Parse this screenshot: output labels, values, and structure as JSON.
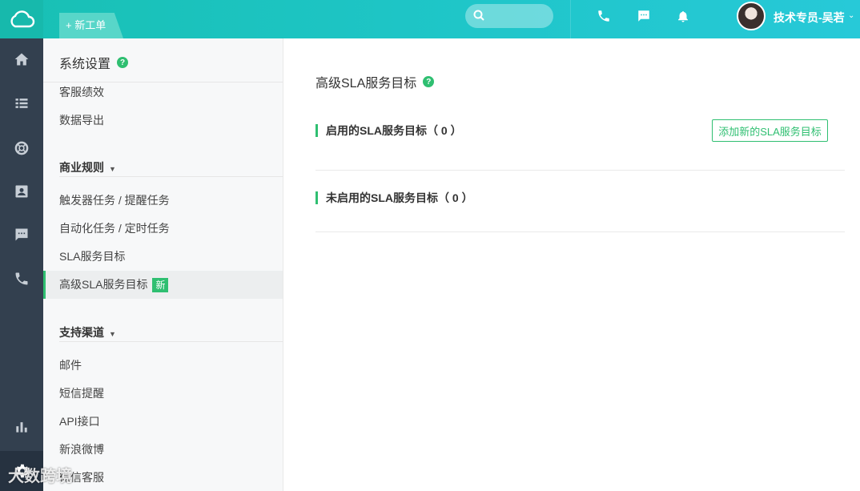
{
  "header": {
    "new_ticket_label": "+ 新工单",
    "search_placeholder": "",
    "user_name": "技术专员-吴若",
    "user_caret": "⌄"
  },
  "rail": {
    "items": [
      "home-icon",
      "list-icon",
      "lifebuoy-icon",
      "contacts-icon",
      "chat-icon",
      "phone-icon",
      "stats-icon",
      "settings-icon"
    ]
  },
  "sidebar": {
    "title": "系统设置",
    "help": "?",
    "items_top": [
      {
        "label": "客服绩效"
      },
      {
        "label": "数据导出"
      }
    ],
    "group_business": {
      "label": "商业规则",
      "caret": "▼",
      "items": [
        {
          "label": "触发器任务 / 提醒任务"
        },
        {
          "label": "自动化任务 / 定时任务"
        },
        {
          "label": "SLA服务目标"
        },
        {
          "label": "高级SLA服务目标",
          "badge": "新"
        }
      ]
    },
    "group_channels": {
      "label": "支持渠道",
      "caret": "▼",
      "items": [
        {
          "label": "邮件"
        },
        {
          "label": "短信提醒"
        },
        {
          "label": "API接口"
        },
        {
          "label": "新浪微博"
        },
        {
          "label": "微信客服"
        }
      ]
    }
  },
  "main": {
    "title": "高级SLA服务目标",
    "help": "?",
    "enabled_section": "启用的SLA服务目标（ 0 ）",
    "disabled_section": "未启用的SLA服务目标（ 0 ）",
    "add_button": "添加新的SLA服务目标"
  },
  "watermark": "大数跨境",
  "colors": {
    "accent": "#2fbf71",
    "topbar": "#1fc6c9",
    "rail": "#33404f"
  }
}
